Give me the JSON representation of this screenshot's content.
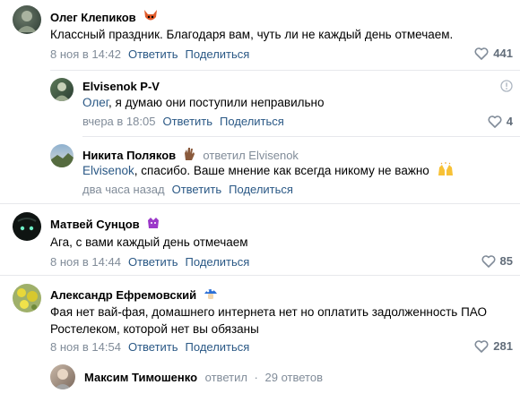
{
  "comments": [
    {
      "author": "Олег Клепиков",
      "text": "Классный праздник. Благодаря вам, чуть ли не каждый день отмечаем.",
      "time": "8 ноя в 14:42",
      "reply": "Ответить",
      "share": "Поделиться",
      "likes": "441"
    },
    {
      "author": "Elvisenok P-V",
      "mention": "Олег",
      "text": ", я думаю они поступили неправильно",
      "time": "вчера в 18:05",
      "reply": "Ответить",
      "share": "Поделиться",
      "likes": "4"
    },
    {
      "author": "Никита Поляков",
      "replied_to": "ответил Elvisenok",
      "mention": "Elvisenok",
      "text": ", спасибо. Ваше мнение как всегда никому не важно",
      "time": "два часа назад",
      "reply": "Ответить",
      "share": "Поделиться"
    },
    {
      "author": "Матвей Сунцов",
      "text": "Ага, с вами каждый день отмечаем",
      "time": "8 ноя в 14:44",
      "reply": "Ответить",
      "share": "Поделиться",
      "likes": "85"
    },
    {
      "author": "Александр Ефремовский",
      "text_line1": "Фая нет вай-фая, домашнего интернета нет но оплатить задолженность ПАО",
      "text_line2": "Ростелеком, которой нет вы обязаны",
      "time": "8 ноя в 14:54",
      "reply": "Ответить",
      "share": "Поделиться",
      "likes": "281"
    }
  ],
  "thread_summary": {
    "author": "Максим Тимошенко",
    "replied": "ответил",
    "count": "29 ответов"
  },
  "colors": {
    "link": "#2a5885",
    "meta": "#818c99",
    "like_count": "#626d7a"
  }
}
